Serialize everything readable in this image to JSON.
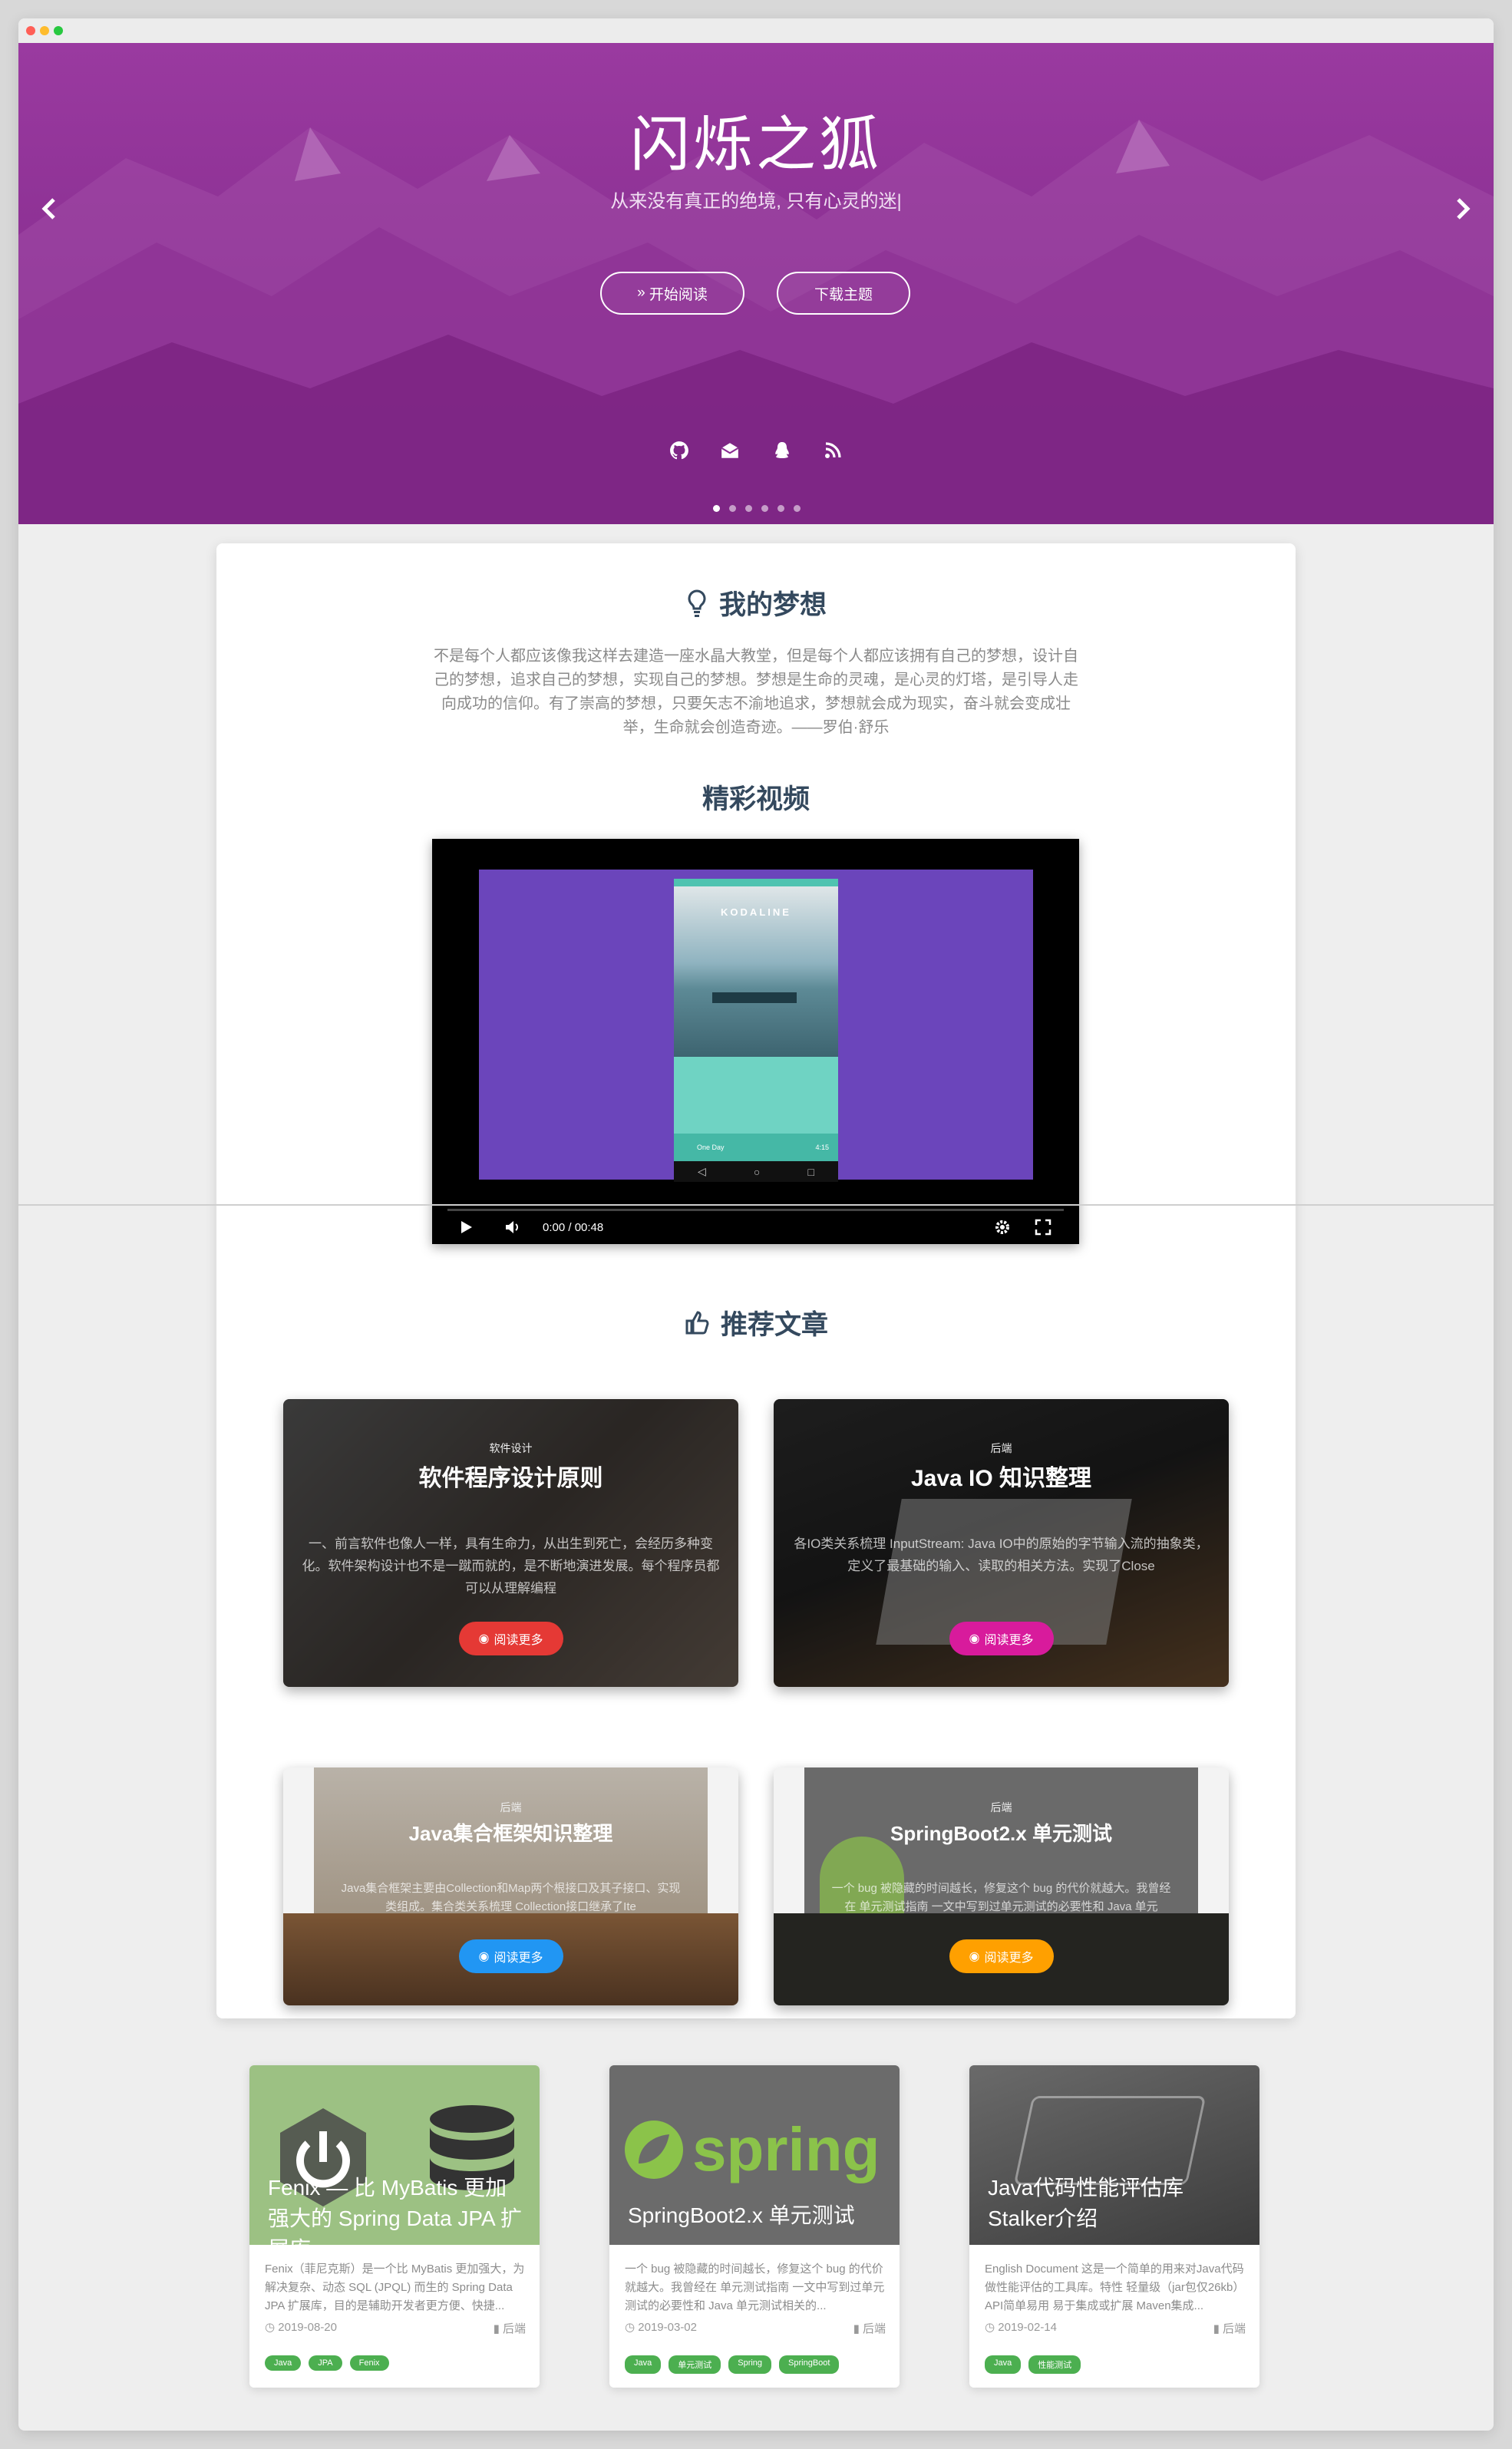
{
  "hero": {
    "title": "闪烁之狐",
    "subtitle": "从来没有真正的绝境, 只有心灵的迷|",
    "btn_read": "开始阅读",
    "btn_download": "下载主题",
    "social_icons": [
      "github-icon",
      "mail-icon",
      "qq-icon",
      "rss-icon"
    ],
    "slide_count": 6,
    "active_slide": 1
  },
  "dream": {
    "title": "我的梦想",
    "text": "不是每个人都应该像我这样去建造一座水晶大教堂，但是每个人都应该拥有自己的梦想，设计自己的梦想，追求自己的梦想，实现自己的梦想。梦想是生命的灵魂，是心灵的灯塔，是引导人走向成功的信仰。有了崇高的梦想，只要矢志不渝地追求，梦想就会成为现实，奋斗就会变成壮举，生命就会创造奇迹。——罗伯·舒乐"
  },
  "video": {
    "title": "精彩视频",
    "time": "0:00 / 00:48",
    "app_name": "KODALINE",
    "track": "One Day",
    "duration": "4:15"
  },
  "recommend": {
    "title": "推荐文章",
    "read_more": "阅读更多",
    "items": [
      {
        "category": "软件设计",
        "title": "软件程序设计原则",
        "desc": "一、前言软件也像人一样，具有生命力，从出生到死亡，会经历多种变化。软件架构设计也不是一蹴而就的，是不断地演进发展。每个程序员都可以从理解编程",
        "color": "#e53935"
      },
      {
        "category": "后端",
        "title": "Java IO 知识整理",
        "desc": "各IO类关系梳理 InputStream: Java IO中的原始的字节输入流的抽象类，定义了最基础的输入、读取的相关方法。实现了Close",
        "color": "#d81b9c"
      },
      {
        "category": "后端",
        "title": "Java集合框架知识整理",
        "desc": "Java集合框架主要由Collection和Map两个根接口及其子接口、实现类组成。集合类关系梳理 Collection接口继承了Ite",
        "color": "#2196f3"
      },
      {
        "category": "后端",
        "title": "SpringBoot2.x 单元测试",
        "desc": "一个 bug 被隐藏的时间越长，修复这个 bug 的代价就越大。我曾经在 单元测试指南 一文中写到过单元测试的必要性和 Java 单元",
        "color": "#ffa000"
      }
    ]
  },
  "posts": [
    {
      "title": "Fenix — 比 MyBatis 更加强大的 Spring Data JPA 扩展库",
      "excerpt": "Fenix（菲尼克斯）是一个比 MyBatis 更加强大，为解决复杂、动态 SQL (JPQL) 而生的 Spring Data JPA 扩展库，目的是辅助开发者更方便、快捷...",
      "date": "2019-08-20",
      "category": "后端",
      "tags": [
        "Java",
        "JPA",
        "Fenix"
      ]
    },
    {
      "title": "SpringBoot2.x 单元测试",
      "excerpt": "一个 bug 被隐藏的时间越长，修复这个 bug 的代价就越大。我曾经在 单元测试指南 一文中写到过单元测试的必要性和 Java 单元测试相关的...",
      "date": "2019-03-02",
      "category": "后端",
      "tags": [
        "Java",
        "单元测试",
        "Spring",
        "SpringBoot"
      ]
    },
    {
      "title": "Java代码性能评估库Stalker介绍",
      "excerpt": "English Document 这是一个简单的用来对Java代码做性能评估的工具库。特性 轻量级（jar包仅26kb） API简单易用 易于集成或扩展 Maven集成...",
      "date": "2019-02-14",
      "category": "后端",
      "tags": [
        "Java",
        "性能测试"
      ]
    }
  ],
  "colors": {
    "hero": "#8a2c92",
    "heading": "#34495e",
    "tag": "#4caf50"
  }
}
